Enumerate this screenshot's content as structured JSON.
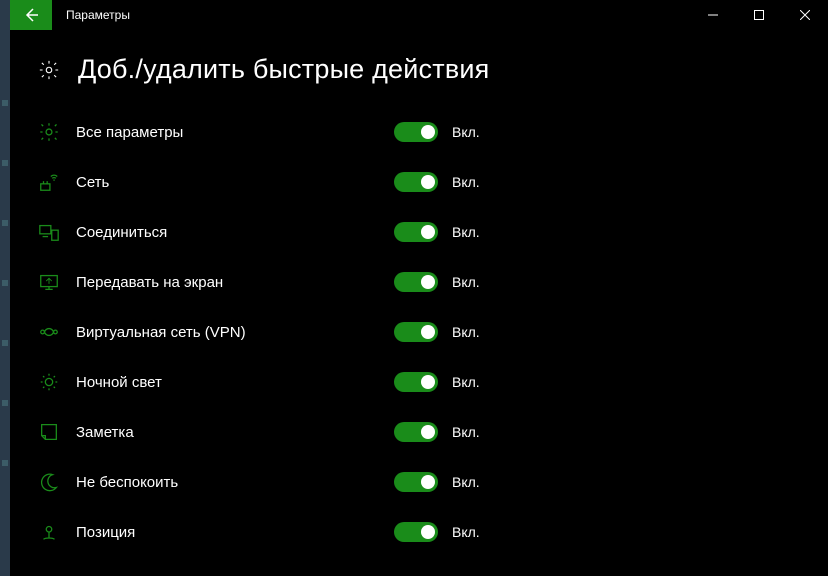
{
  "window": {
    "title": "Параметры"
  },
  "page": {
    "heading": "Доб./удалить быстрые действия"
  },
  "state_on_label": "Вкл.",
  "items": [
    {
      "label": "Все параметры",
      "icon": "gear",
      "on": true
    },
    {
      "label": "Сеть",
      "icon": "network",
      "on": true
    },
    {
      "label": "Соединиться",
      "icon": "connect",
      "on": true
    },
    {
      "label": "Передавать на экран",
      "icon": "project",
      "on": true
    },
    {
      "label": "Виртуальная сеть (VPN)",
      "icon": "vpn",
      "on": true
    },
    {
      "label": "Ночной свет",
      "icon": "nightlight",
      "on": true
    },
    {
      "label": "Заметка",
      "icon": "note",
      "on": true
    },
    {
      "label": "Не беспокоить",
      "icon": "moon",
      "on": true
    },
    {
      "label": "Позиция",
      "icon": "location",
      "on": true
    }
  ]
}
